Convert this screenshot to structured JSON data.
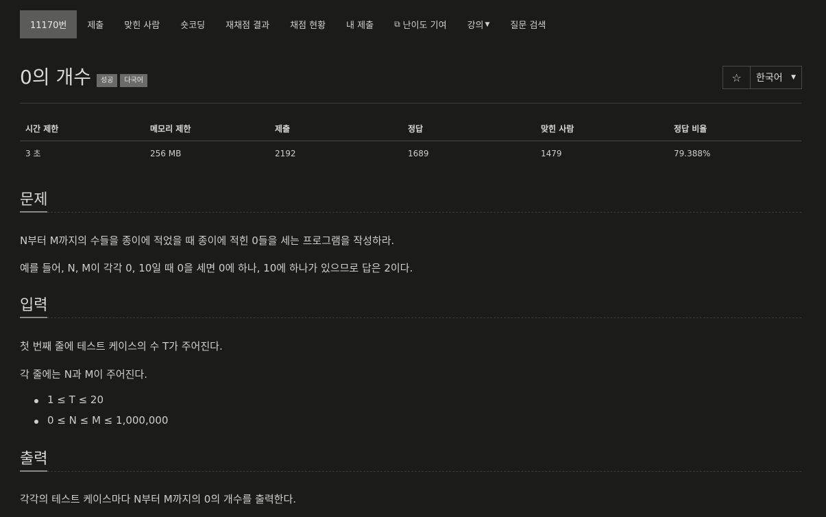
{
  "nav": {
    "items": [
      {
        "label": "11170번",
        "active": true
      },
      {
        "label": "제출"
      },
      {
        "label": "맞힌 사람"
      },
      {
        "label": "숏코딩"
      },
      {
        "label": "재채점 결과"
      },
      {
        "label": "채점 현황"
      },
      {
        "label": "내 제출"
      },
      {
        "label": "난이도 기여",
        "icon": "external-link-icon"
      },
      {
        "label": "강의",
        "dropdown": true
      },
      {
        "label": "질문 검색"
      }
    ]
  },
  "problem": {
    "title": "0의 개수",
    "labels": [
      "성공",
      "다국어"
    ],
    "star": "☆",
    "language": "한국어"
  },
  "info": {
    "headers": [
      "시간 제한",
      "메모리 제한",
      "제출",
      "정답",
      "맞힌 사람",
      "정답 비율"
    ],
    "values": [
      "3 초",
      "256 MB",
      "2192",
      "1689",
      "1479",
      "79.388%"
    ]
  },
  "sections": {
    "description": {
      "title": "문제",
      "paragraphs": [
        "N부터 M까지의 수들을 종이에 적었을 때 종이에 적힌 0들을 세는 프로그램을 작성하라.",
        "예를 들어, N, M이 각각 0, 10일 때 0을 세면 0에 하나, 10에 하나가 있으므로 답은 2이다."
      ]
    },
    "input": {
      "title": "입력",
      "paragraphs": [
        "첫 번째 줄에 테스트 케이스의 수 T가 주어진다.",
        "각 줄에는 N과 M이 주어진다."
      ],
      "constraints": [
        "1 ≤ T ≤ 20",
        "0 ≤ N ≤ M ≤ 1,000,000"
      ]
    },
    "output": {
      "title": "출력",
      "paragraphs": [
        "각각의 테스트 케이스마다 N부터 M까지의 0의 개수를 출력한다."
      ]
    }
  }
}
